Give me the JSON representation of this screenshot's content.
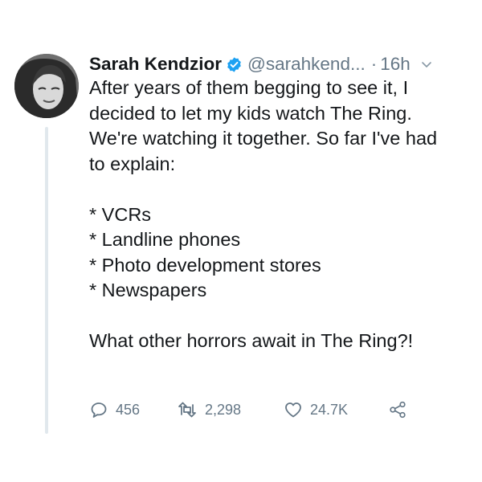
{
  "tweet": {
    "author": {
      "display_name": "Sarah Kendzior",
      "handle": "@sarahkend...",
      "verified": true
    },
    "separator": "·",
    "timestamp": "16h",
    "body": {
      "intro": [
        "After years of them begging to see it, I",
        "decided to let my kids watch The Ring.",
        "We're watching it together. So far I've had",
        "to explain:"
      ],
      "list": [
        "* VCRs",
        "* Landline phones",
        "* Photo development stores",
        "* Newspapers"
      ],
      "closing": "What other horrors await in The Ring?!"
    },
    "actions": {
      "replies": "456",
      "retweets": "2,298",
      "likes": "24.7K"
    }
  },
  "colors": {
    "text": "#14171a",
    "muted": "#657786",
    "verified": "#1da1f2",
    "thread_line": "#e1e8ed"
  },
  "icons": [
    "verified-icon",
    "chevron-down-icon",
    "reply-icon",
    "retweet-icon",
    "like-icon",
    "share-icon"
  ]
}
